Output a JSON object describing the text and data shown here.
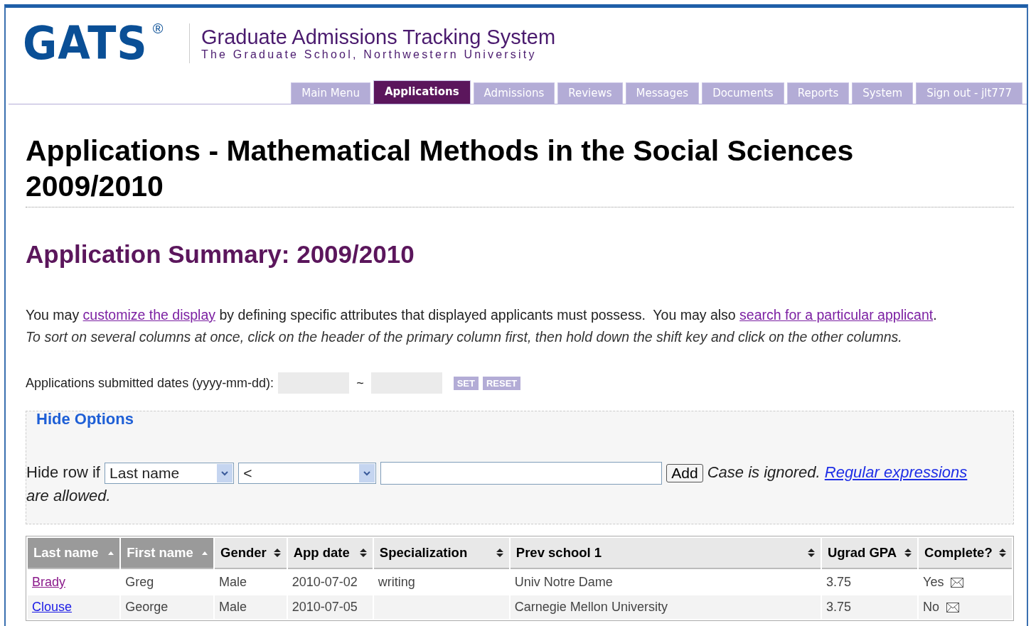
{
  "header": {
    "logo": "GATS",
    "logo_mark": "®",
    "title": "Graduate Admissions Tracking System",
    "subtitle": "The Graduate School,  Northwestern University"
  },
  "tabs": [
    {
      "label": "Main Menu",
      "selected": false
    },
    {
      "label": "Applications",
      "selected": true
    },
    {
      "label": "Admissions",
      "selected": false
    },
    {
      "label": "Reviews",
      "selected": false
    },
    {
      "label": "Messages",
      "selected": false
    },
    {
      "label": "Documents",
      "selected": false
    },
    {
      "label": "Reports",
      "selected": false
    },
    {
      "label": "System",
      "selected": false
    },
    {
      "label": "Sign out - jlt777",
      "selected": false
    }
  ],
  "page_title": "Applications - Mathematical Methods in the Social Sciences 2009/2010",
  "summary_title": "Application Summary:  2009/2010",
  "intro": [
    {
      "kind": "text",
      "text": "You may "
    },
    {
      "kind": "link",
      "text": "customize the display"
    },
    {
      "kind": "text",
      "text": " by defining specific attributes that displayed applicants must possess.  You may also "
    },
    {
      "kind": "link",
      "text": "search for a particular applicant"
    },
    {
      "kind": "text",
      "text": "."
    }
  ],
  "sort_hint": "To sort on several columns at once, click on the header of the primary column first, then hold down the shift key and click on the other columns.",
  "date_filter": {
    "label": "Applications submitted dates (yyyy-mm-dd):",
    "separator": "~",
    "buttons": [
      "SET",
      "RESET"
    ]
  },
  "hide_options": {
    "legend": "Hide Options",
    "label": "Hide row if",
    "field_select": "Last name",
    "operator_select": "<",
    "button": "Add",
    "note": "Case is ignored.",
    "link": "Regular expressions",
    "note_end": "are allowed."
  },
  "table": {
    "columns": [
      {
        "label": "Last name",
        "sorted": true
      },
      {
        "label": "First name",
        "sorted": true
      },
      {
        "label": "Gender",
        "sorted": false
      },
      {
        "label": "App date",
        "sorted": false
      },
      {
        "label": "Specialization",
        "sorted": false
      },
      {
        "label": "Prev school 1",
        "sorted": false
      },
      {
        "label": "Ugrad GPA",
        "sorted": false
      },
      {
        "label": "Complete?",
        "sorted": false
      }
    ],
    "rows": [
      {
        "last_name": "Brady",
        "visited": true,
        "first_name": "Greg",
        "gender": "Male",
        "app_date": "2010-07-02",
        "specialization": "writing",
        "prev_school": "Univ Notre Dame",
        "gpa": "3.75",
        "complete": "Yes"
      },
      {
        "last_name": "Clouse",
        "visited": false,
        "first_name": "George",
        "gender": "Male",
        "app_date": "2010-07-05",
        "prev_school": "Carnegie Mellon University",
        "gpa": "3.75",
        "complete": "No"
      }
    ]
  }
}
